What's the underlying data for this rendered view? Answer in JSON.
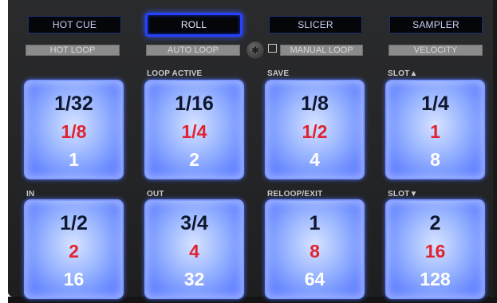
{
  "mode_buttons": [
    {
      "label": "HOT CUE"
    },
    {
      "label": "ROLL"
    },
    {
      "label": "SLICER"
    },
    {
      "label": "SAMPLER"
    }
  ],
  "sub_buttons": [
    {
      "label": "HOT LOOP"
    },
    {
      "label": "AUTO LOOP"
    },
    {
      "label": "MANUAL LOOP"
    },
    {
      "label": "VELOCITY"
    }
  ],
  "pad_labels": {
    "loop_active": "LOOP ACTIVE",
    "save": "SAVE",
    "slot_up": "SLOT▲",
    "in": "IN",
    "out": "OUT",
    "reloop_exit": "RELOOP/EXIT",
    "slot_down": "SLOT▼"
  },
  "pads": [
    {
      "top": "1/32",
      "mid": "1/8",
      "bottom": "1"
    },
    {
      "top": "1/16",
      "mid": "1/4",
      "bottom": "2"
    },
    {
      "top": "1/8",
      "mid": "1/2",
      "bottom": "4"
    },
    {
      "top": "1/4",
      "mid": "1",
      "bottom": "8"
    },
    {
      "top": "1/2",
      "mid": "2",
      "bottom": "16"
    },
    {
      "top": "3/4",
      "mid": "4",
      "bottom": "32"
    },
    {
      "top": "1",
      "mid": "8",
      "bottom": "64"
    },
    {
      "top": "2",
      "mid": "16",
      "bottom": "128"
    }
  ],
  "colors": {
    "active_mode_border": "#2541ff",
    "pad_glow": "#6c8cff",
    "pad_mid_text": "#e0242f",
    "pad_top_text": "#0f1830",
    "pad_bottom_text": "#ffffff"
  },
  "icons": {
    "shift": "asterisk-icon",
    "manual_loop": "checkbox-icon"
  }
}
